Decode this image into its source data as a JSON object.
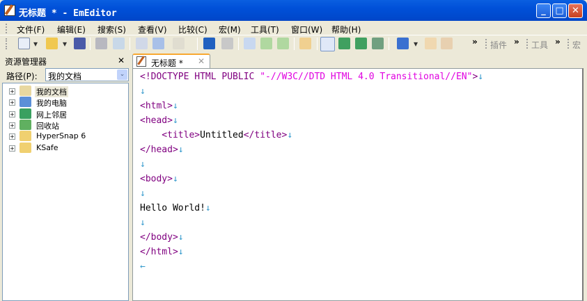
{
  "window": {
    "title": "无标题 * - EmEditor",
    "minimize": "_",
    "maximize": "□",
    "close": "✕"
  },
  "menu": [
    "文件(F)",
    "编辑(E)",
    "搜索(S)",
    "查看(V)",
    "比较(C)",
    "宏(M)",
    "工具(T)",
    "窗口(W)",
    "帮助(H)"
  ],
  "toolbar": {
    "chevron": "»",
    "plugins_label": "插件",
    "tools_label": "工具",
    "macro_label": "宏",
    "dropdown": "▾"
  },
  "explorer": {
    "title": "资源管理器",
    "close": "✕",
    "path_label": "路径(P):",
    "path_value": "我的文档",
    "combo_arrow": "⌄",
    "items": [
      {
        "label": "我的文档",
        "icon": "documents-icon",
        "color": "#e8d8a0"
      },
      {
        "label": "我的电脑",
        "icon": "computer-icon",
        "color": "#5b8fd8"
      },
      {
        "label": "网上邻居",
        "icon": "network-icon",
        "color": "#3aa060"
      },
      {
        "label": "回收站",
        "icon": "recycle-bin-icon",
        "color": "#60b060"
      },
      {
        "label": "HyperSnap 6",
        "icon": "folder-icon",
        "color": "#f0d070"
      },
      {
        "label": "KSafe",
        "icon": "folder-icon",
        "color": "#f0d070"
      }
    ],
    "expander": "+"
  },
  "tab": {
    "label": "无标题 *",
    "close": "✕"
  },
  "editor": {
    "lines": [
      [
        {
          "t": "<!DOCTYPE HTML PUBLIC ",
          "c": "tag"
        },
        {
          "t": "\"-//W3C//DTD HTML 4.0 Transitional//EN\"",
          "c": "str"
        },
        {
          "t": ">",
          "c": "tag"
        },
        {
          "t": "↓",
          "c": "nl"
        }
      ],
      [
        {
          "t": "↓",
          "c": "nl"
        }
      ],
      [
        {
          "t": "<html>",
          "c": "tag"
        },
        {
          "t": "↓",
          "c": "nl"
        }
      ],
      [
        {
          "t": "<head>",
          "c": "tag"
        },
        {
          "t": "↓",
          "c": "nl"
        }
      ],
      [
        {
          "t": "    <title>",
          "c": "tag"
        },
        {
          "t": "Untitled",
          "c": ""
        },
        {
          "t": "</title>",
          "c": "tag"
        },
        {
          "t": "↓",
          "c": "nl"
        }
      ],
      [
        {
          "t": "</head>",
          "c": "tag"
        },
        {
          "t": "↓",
          "c": "nl"
        }
      ],
      [
        {
          "t": "↓",
          "c": "nl"
        }
      ],
      [
        {
          "t": "<body>",
          "c": "tag"
        },
        {
          "t": "↓",
          "c": "nl"
        }
      ],
      [
        {
          "t": "↓",
          "c": "nl"
        }
      ],
      [
        {
          "t": "Hello World!",
          "c": ""
        },
        {
          "t": "↓",
          "c": "nl"
        }
      ],
      [
        {
          "t": "↓",
          "c": "nl"
        }
      ],
      [
        {
          "t": "</body>",
          "c": "tag"
        },
        {
          "t": "↓",
          "c": "nl"
        }
      ],
      [
        {
          "t": "</html>",
          "c": "tag"
        },
        {
          "t": "↓",
          "c": "nl"
        }
      ],
      [
        {
          "t": "←",
          "c": "nl"
        }
      ]
    ]
  }
}
